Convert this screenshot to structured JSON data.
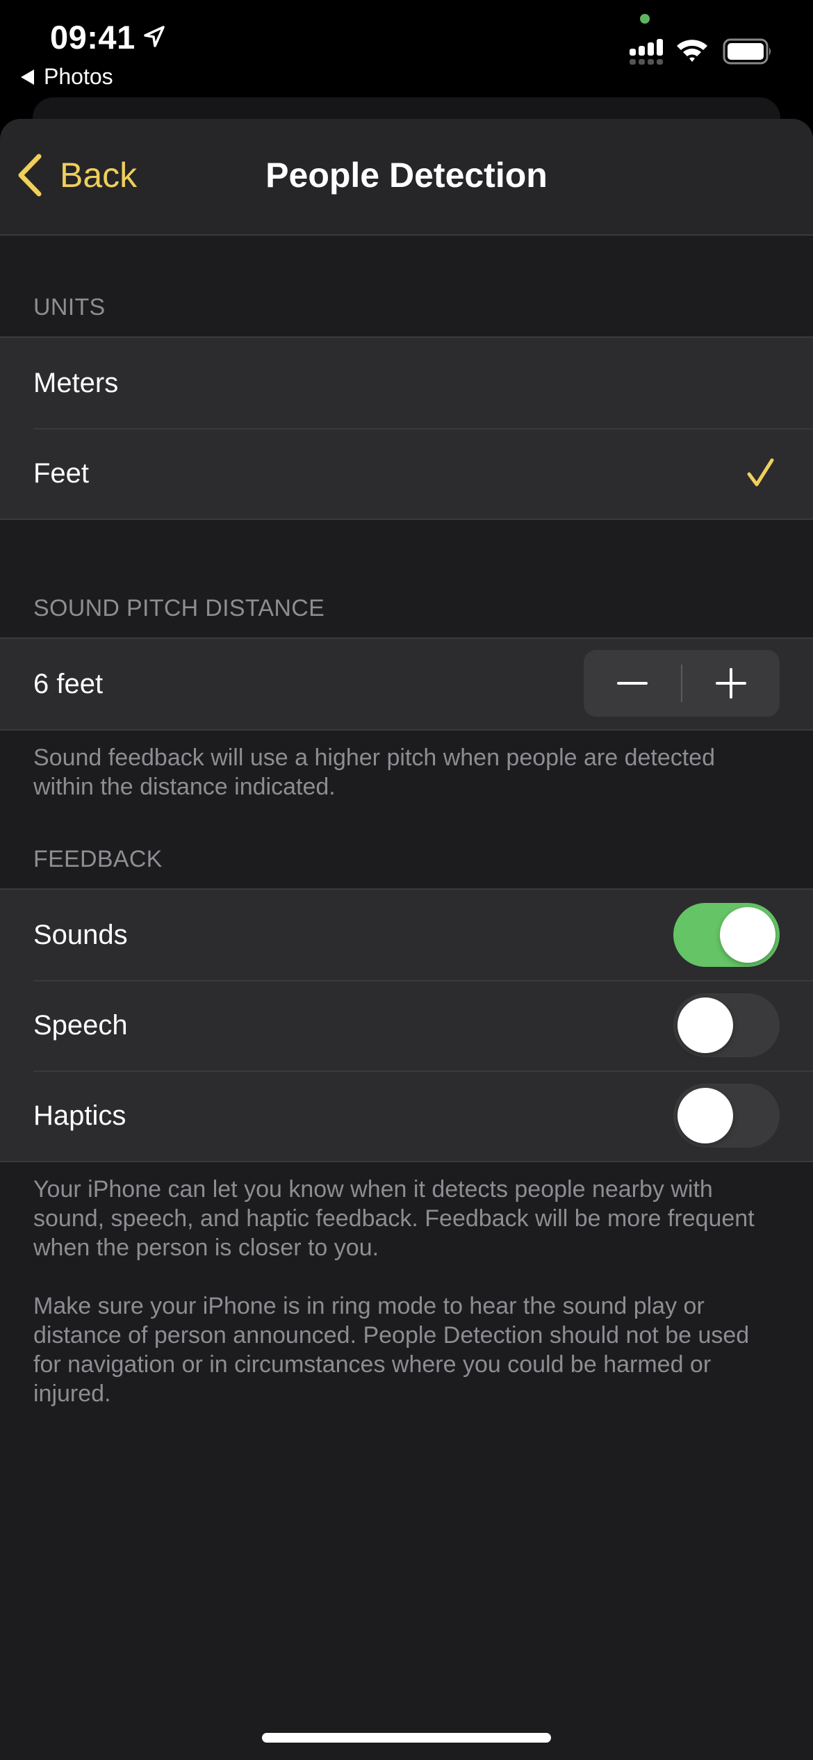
{
  "status_bar": {
    "time": "09:41",
    "back_app_label": "Photos",
    "icons": [
      "location-arrow-icon",
      "cellular-signal-icon",
      "wifi-icon",
      "battery-icon"
    ],
    "camera_indicator_color": "#5fb55f"
  },
  "navbar": {
    "back_label": "Back",
    "title": "People Detection",
    "accent_color": "#f0cf5b"
  },
  "units": {
    "header": "UNITS",
    "options": [
      {
        "label": "Meters",
        "selected": false
      },
      {
        "label": "Feet",
        "selected": true
      }
    ]
  },
  "sound_pitch_distance": {
    "header": "SOUND PITCH DISTANCE",
    "value": "6 feet",
    "decrement_symbol": "−",
    "increment_symbol": "+",
    "footer": "Sound feedback will use a higher pitch when people are detected within the distance indicated."
  },
  "feedback": {
    "header": "FEEDBACK",
    "items": [
      {
        "label": "Sounds",
        "enabled": true
      },
      {
        "label": "Speech",
        "enabled": false
      },
      {
        "label": "Haptics",
        "enabled": false
      }
    ],
    "toggle_on_color": "#65c466",
    "footer_paragraphs": [
      "Your iPhone can let you know when it detects people nearby with sound, speech, and haptic feedback. Feedback will be more frequent when the person is closer to you.",
      "Make sure your iPhone is in ring mode to hear the sound play or distance of person announced. People Detection should not be used for navigation or in circumstances where you could be harmed or injured."
    ]
  }
}
